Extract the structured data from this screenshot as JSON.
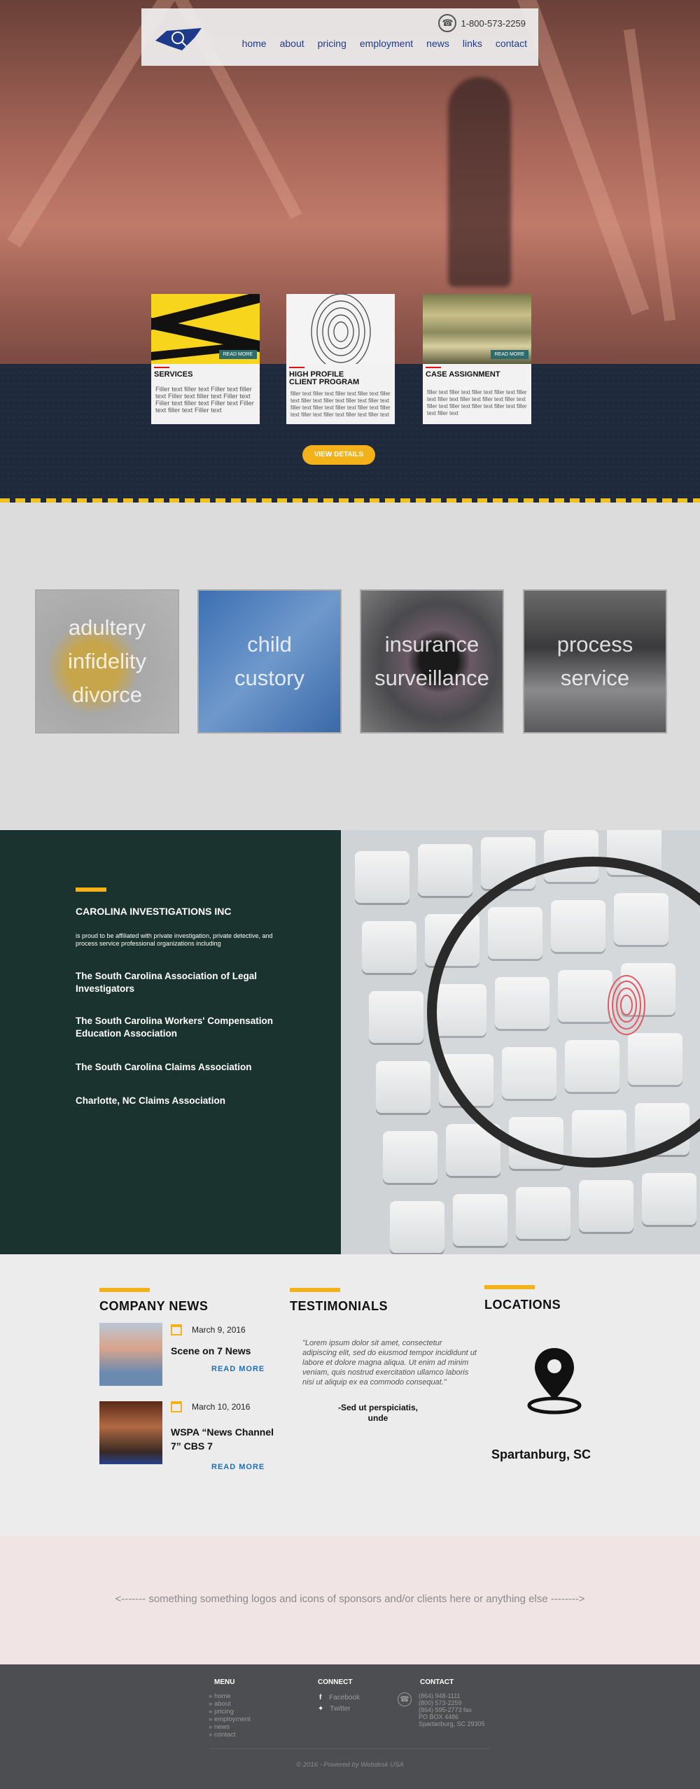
{
  "header": {
    "phone": "1-800-573-2259",
    "menu": [
      "home",
      "about",
      "pricing",
      "employment",
      "news",
      "links",
      "contact"
    ]
  },
  "features": [
    {
      "title": "SERVICES",
      "text": "Filler text filler text Filler text filler text Filler text filler text Filler text Filler text filler text Filler text Filler text filler text Filler text",
      "read_more": "READ MORE"
    },
    {
      "title": "HIGH PROFILE CLIENT PROGRAM",
      "text": "filler text filler text filler text filler text filler text filler text filler text filler text filler text filler text filler text filler text filler text filler text filler text filler text filler text filler text"
    },
    {
      "title": "CASE ASSIGNMENT",
      "text": "filler text filler text filler text filler text filler text filler text filler text filler text filler text filler text filler text filler text filler text filler text filler text",
      "read_more": "READ MORE"
    }
  ],
  "view_details": "VIEW DETAILS",
  "services": [
    {
      "lines": [
        "adultery",
        "infidelity",
        "divorce"
      ]
    },
    {
      "lines": [
        "child",
        "custory"
      ]
    },
    {
      "lines": [
        "insurance",
        "surveillance"
      ]
    },
    {
      "lines": [
        "process",
        "service"
      ]
    }
  ],
  "about": {
    "company": "CAROLINA INVESTIGATIONS INC",
    "subtitle": "is proud to be affiliated with private investigation, private detective, and process service professional organizations including",
    "orgs": [
      "The South Carolina Association of Legal Investigators",
      "The South Carolina Workers' Compensation Education Association",
      "The South Carolina Claims Association",
      "Charlotte, NC Claims Association"
    ]
  },
  "news": {
    "title": "COMPANY NEWS",
    "items": [
      {
        "date": "March 9, 2016",
        "headline": "Scene on 7 News",
        "read_more": "READ MORE"
      },
      {
        "date": "March 10, 2016",
        "headline": "WSPA “News Channel 7” CBS 7",
        "read_more": "READ MORE"
      }
    ]
  },
  "testimonials": {
    "title": "TESTIMONIALS",
    "quote": "\"Lorem ipsum dolor sit amet, consectetur adipiscing elit, sed do eiusmod tempor incididunt ut labore et dolore magna aliqua. Ut enim ad minim veniam, quis nostrud exercitation ullamco laboris nisi ut aliquip ex ea commodo consequat.\"",
    "author": "-Sed ut perspiciatis, unde"
  },
  "locations": {
    "title": "LOCATIONS",
    "city": "Spartanburg, SC"
  },
  "sponsors": "<------- something something logos and icons of sponsors and/or clients here or anything else -------->",
  "footer": {
    "menu_title": "MENU",
    "menu": [
      "home",
      "about",
      "pricing",
      "employment",
      "news",
      "contact"
    ],
    "connect_title": "CONNECT",
    "facebook": "Facebook",
    "twitter": "Twitter",
    "contact_title": "CONTACT",
    "contact_lines": [
      "(864) 948-1111",
      "(800) 573-2259",
      "(864) 595-2773 fax",
      "PO BOX 4486",
      "Spartanburg, SC 29305"
    ],
    "copyright": "© 2016 - Powered by Webdesk USA"
  }
}
